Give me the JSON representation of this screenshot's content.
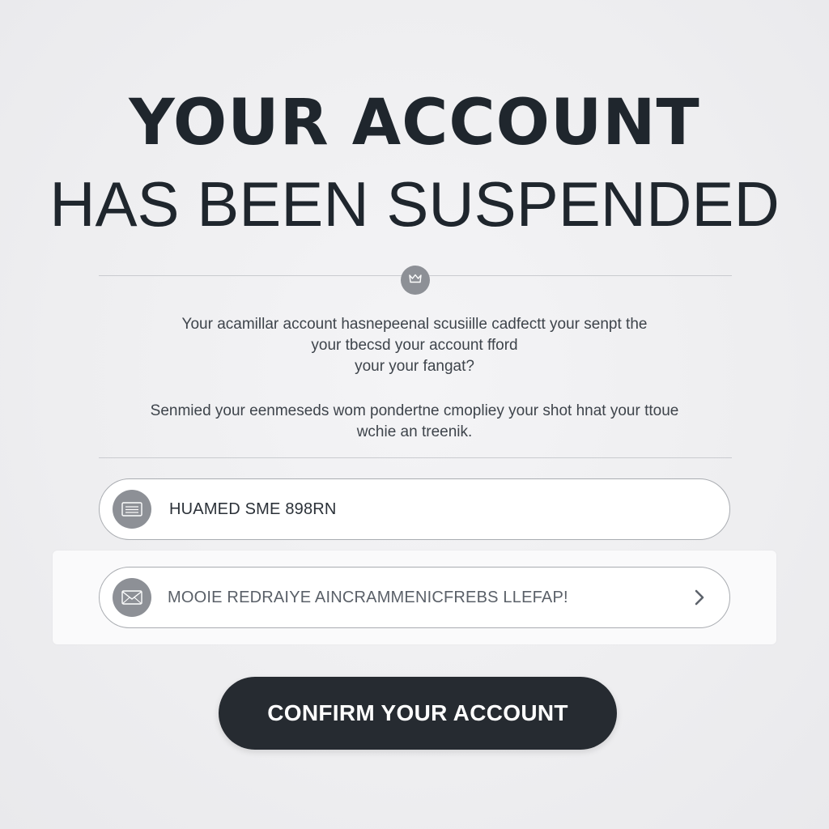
{
  "header": {
    "title_line_1": "YOUR ACCOUNT",
    "title_line_2": "HAS BEEN SUSPENDED"
  },
  "divider": {
    "icon": "crown-icon"
  },
  "message": {
    "paragraph_1": [
      "Your acamillar account hasnepeenal scusiille cadfectt your senpt the",
      "your tbecsd your account fford",
      "your your fangat?"
    ],
    "paragraph_2": [
      "Senmied your eenmeseds wom pondertne cmopliey your shot hnat your ttoue",
      "wchie an treenik."
    ]
  },
  "fields": {
    "name": {
      "icon": "id-card-icon",
      "value": "HUAMED SME 898RN"
    },
    "email": {
      "icon": "envelope-icon",
      "value": "MOOIE REDRAIYE AINCRAMMENICFREBS LLEFAP!",
      "action_icon": "chevron-right-icon"
    }
  },
  "actions": {
    "confirm_label": "CONFIRM YOUR ACCOUNT"
  },
  "colors": {
    "background": "#eeeef0",
    "primary_dark": "#262b31",
    "icon_gray": "#8d9096",
    "field_border": "#a9acb1"
  }
}
